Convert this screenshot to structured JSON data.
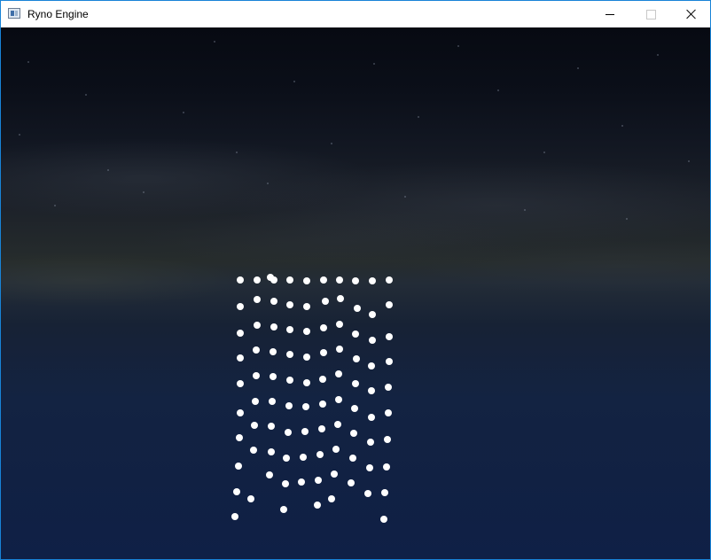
{
  "window": {
    "title": "Ryno Engine"
  },
  "icons": {
    "app": "app-window-icon",
    "minimize": "minimize-icon",
    "maximize": "maximize-icon",
    "close": "close-icon"
  },
  "colors": {
    "window_border": "#1883d7",
    "particle": "#ffffff",
    "sky_top": "#070a12",
    "horizon": "#262c2c",
    "ocean": "#0f2046"
  }
}
